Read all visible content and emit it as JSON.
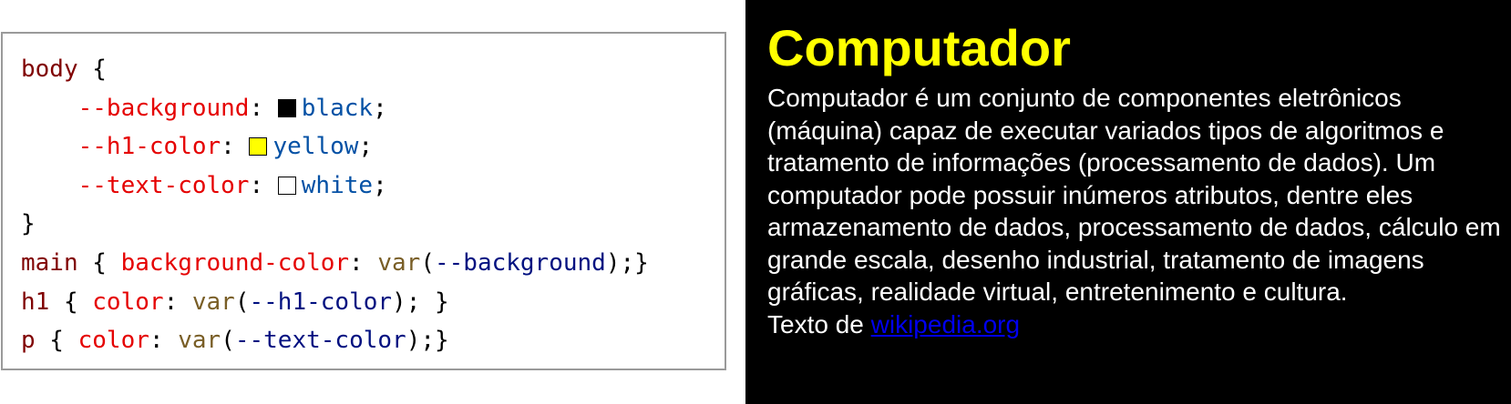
{
  "code_panel": {
    "lines": [
      [
        {
          "t": "sel",
          "v": "body"
        },
        {
          "t": "punc",
          "v": " {"
        }
      ],
      [
        {
          "t": "punc",
          "v": "    "
        },
        {
          "t": "prop",
          "v": "--background"
        },
        {
          "t": "punc",
          "v": ": "
        },
        {
          "t": "swatch",
          "color": "#000000"
        },
        {
          "t": "val",
          "v": "black"
        },
        {
          "t": "punc",
          "v": ";"
        }
      ],
      [
        {
          "t": "punc",
          "v": "    "
        },
        {
          "t": "prop",
          "v": "--h1-color"
        },
        {
          "t": "punc",
          "v": ": "
        },
        {
          "t": "swatch",
          "color": "#ffff00"
        },
        {
          "t": "val",
          "v": "yellow"
        },
        {
          "t": "punc",
          "v": ";"
        }
      ],
      [
        {
          "t": "punc",
          "v": "    "
        },
        {
          "t": "prop",
          "v": "--text-color"
        },
        {
          "t": "punc",
          "v": ": "
        },
        {
          "t": "swatch",
          "color": "#ffffff"
        },
        {
          "t": "val",
          "v": "white"
        },
        {
          "t": "punc",
          "v": ";"
        }
      ],
      [
        {
          "t": "punc",
          "v": "}"
        }
      ],
      [
        {
          "t": "sel",
          "v": "main"
        },
        {
          "t": "punc",
          "v": " { "
        },
        {
          "t": "prop",
          "v": "background-color"
        },
        {
          "t": "punc",
          "v": ": "
        },
        {
          "t": "fn",
          "v": "var"
        },
        {
          "t": "punc",
          "v": "("
        },
        {
          "t": "var",
          "v": "--background"
        },
        {
          "t": "punc",
          "v": ");}"
        }
      ],
      [
        {
          "t": "sel",
          "v": "h1"
        },
        {
          "t": "punc",
          "v": " { "
        },
        {
          "t": "prop",
          "v": "color"
        },
        {
          "t": "punc",
          "v": ": "
        },
        {
          "t": "fn",
          "v": "var"
        },
        {
          "t": "punc",
          "v": "("
        },
        {
          "t": "var",
          "v": "--h1-color"
        },
        {
          "t": "punc",
          "v": "); }"
        }
      ],
      [
        {
          "t": "sel",
          "v": "p"
        },
        {
          "t": "punc",
          "v": " { "
        },
        {
          "t": "prop",
          "v": "color"
        },
        {
          "t": "punc",
          "v": ": "
        },
        {
          "t": "fn",
          "v": "var"
        },
        {
          "t": "punc",
          "v": "("
        },
        {
          "t": "var",
          "v": "--text-color"
        },
        {
          "t": "punc",
          "v": ");}"
        }
      ]
    ]
  },
  "preview": {
    "background": "#000000",
    "heading": "Computador",
    "heading_color": "#ffff00",
    "text_color": "#ffffff",
    "paragraph": "Computador é um conjunto de componentes eletrônicos (máquina) capaz de executar variados tipos de algoritmos e tratamento de informações (processamento de dados). Um computador pode possuir inúmeros atributos, dentre eles armazenamento de dados, processamento de dados, cálculo em grande escala, desenho industrial, tratamento de imagens gráficas, realidade virtual, entretenimento e cultura.",
    "source_prefix": "Texto de ",
    "source_link": "wikipedia.org"
  }
}
